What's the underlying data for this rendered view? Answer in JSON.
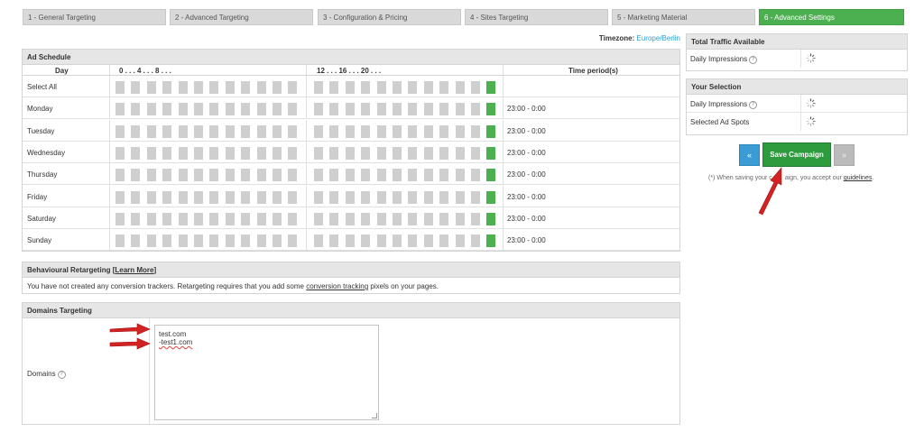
{
  "tabs": [
    {
      "label": "1 - General Targeting",
      "active": false
    },
    {
      "label": "2 - Advanced Targeting",
      "active": false
    },
    {
      "label": "3 - Configuration & Pricing",
      "active": false
    },
    {
      "label": "4 - Sites Targeting",
      "active": false
    },
    {
      "label": "5 - Marketing Material",
      "active": false
    },
    {
      "label": "6 - Advanced Settings",
      "active": true
    }
  ],
  "timezone": {
    "label": "Timezone:",
    "value": "Europe/Berlin"
  },
  "schedule": {
    "title": "Ad Schedule",
    "col_day": "Day",
    "col_period": "Time period(s)",
    "hours_am": "0  .  .  .  4  .  .  .  8  .  .  .",
    "hours_pm": "12  .  .  .  16  .  .  .  20  .  .  .",
    "rows": [
      {
        "day": "Select All",
        "period": ""
      },
      {
        "day": "Monday",
        "period": "23:00 - 0:00"
      },
      {
        "day": "Tuesday",
        "period": "23:00 - 0:00"
      },
      {
        "day": "Wednesday",
        "period": "23:00 - 0:00"
      },
      {
        "day": "Thursday",
        "period": "23:00 - 0:00"
      },
      {
        "day": "Friday",
        "period": "23:00 - 0:00"
      },
      {
        "day": "Saturday",
        "period": "23:00 - 0:00"
      },
      {
        "day": "Sunday",
        "period": "23:00 - 0:00"
      }
    ],
    "active_hour": 23,
    "colors": {
      "cell_off": "#cfcfcf",
      "cell_on": "#4caf50"
    }
  },
  "behavioural": {
    "title": "Behavioural Retargeting",
    "learn_more": "Learn More",
    "text_before": "You have not created any conversion trackers. Retargeting requires that you add some",
    "link": "conversion tracking",
    "text_after": "pixels on your pages."
  },
  "domains": {
    "title": "Domains Targeting",
    "label": "Domains",
    "lines": [
      "test.com",
      "-test1.com"
    ],
    "help_icon": "question-icon"
  },
  "traffic": {
    "title": "Total Traffic Available",
    "rows": [
      {
        "label": "Daily Impressions"
      }
    ]
  },
  "selection": {
    "title": "Your Selection",
    "rows": [
      {
        "label": "Daily Impressions"
      },
      {
        "label": "Selected Ad Spots"
      }
    ]
  },
  "buttons": {
    "prev": "«",
    "save": "Save Campaign",
    "next": "»"
  },
  "note": {
    "before": "(*) When saving your c",
    "middle": "aign, you accept our",
    "link": "guidelines",
    "after": "."
  },
  "accent_colors": {
    "active_tab": "#4caf50",
    "save": "#2e9b3e",
    "prev": "#3a9bd5",
    "link": "#2a9fd6",
    "arrow": "#d32222"
  }
}
